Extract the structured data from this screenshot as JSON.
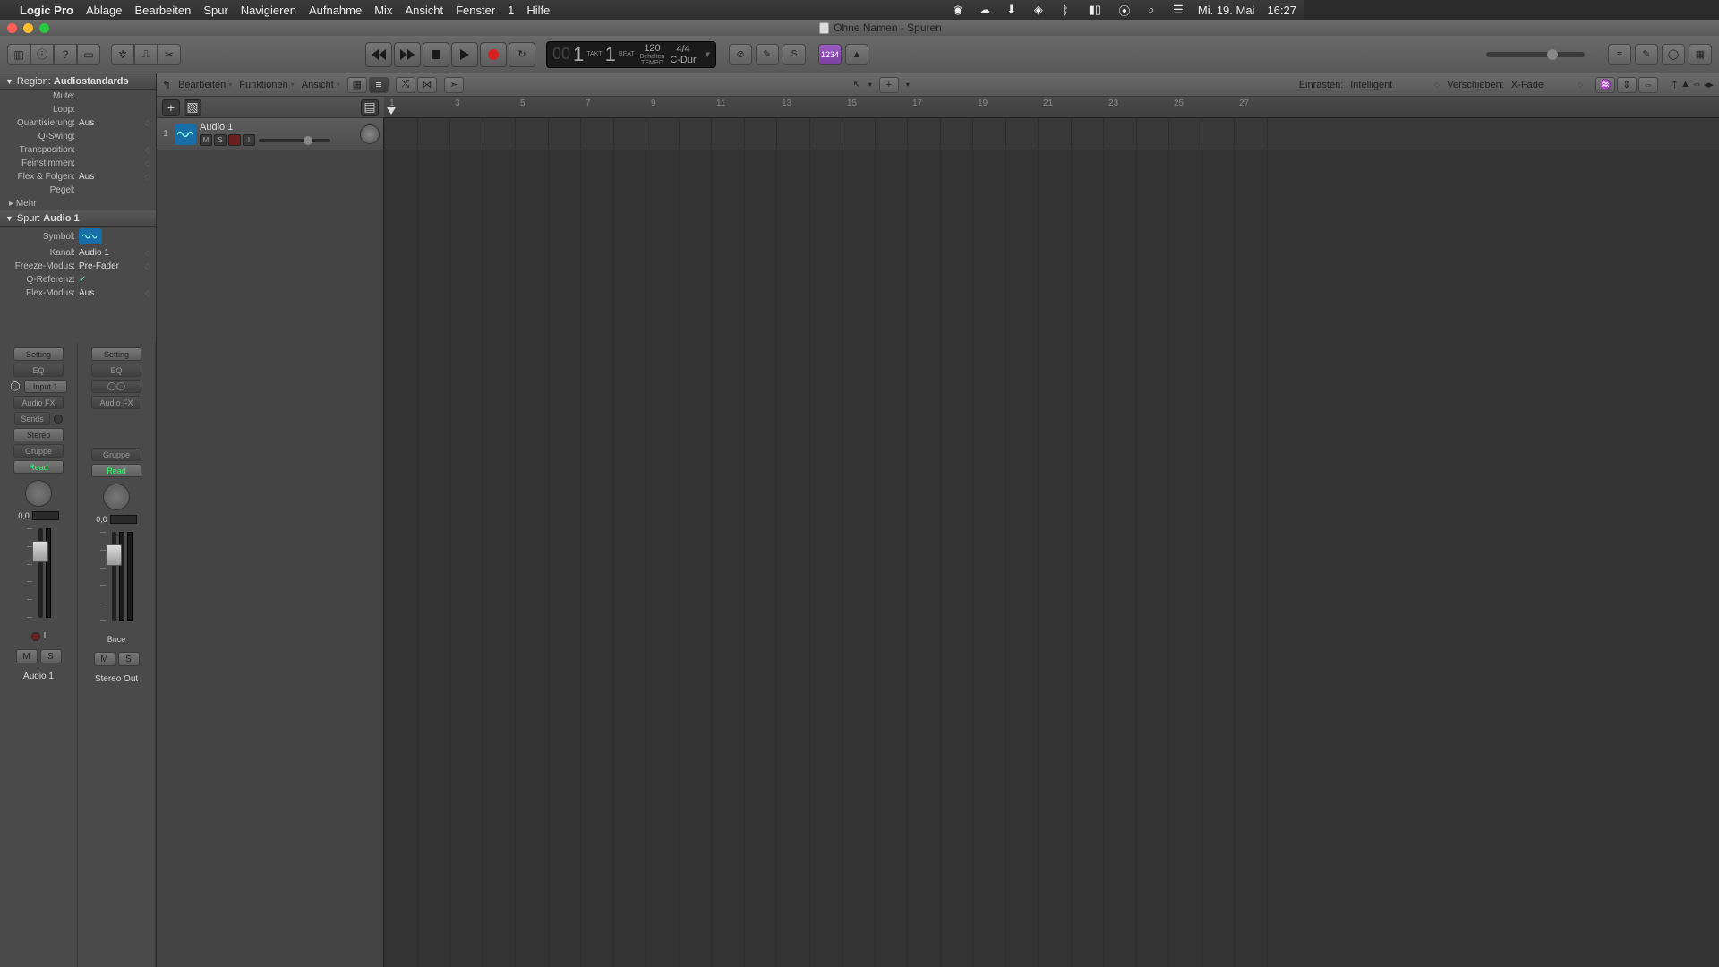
{
  "menubar": {
    "app": "Logic Pro",
    "items": [
      "Ablage",
      "Bearbeiten",
      "Spur",
      "Navigieren",
      "Aufnahme",
      "Mix",
      "Ansicht",
      "Fenster",
      "1",
      "Hilfe"
    ],
    "date": "Mi. 19. Mai",
    "time": "16:27"
  },
  "window": {
    "title": "Ohne Namen - Spuren"
  },
  "lcd": {
    "bar": "1",
    "beat": "1",
    "bar_label": "TAKT",
    "beat_label": "BEAT",
    "tempo": "120",
    "tempo_sub": "Behalten",
    "tempo_label": "TEMPO",
    "sig": "4/4",
    "key": "C-Dur"
  },
  "count_in": "1234",
  "tracks_tb": {
    "edit": "Bearbeiten",
    "funcs": "Funktionen",
    "view": "Ansicht",
    "snap_label": "Einrasten:",
    "snap_value": "Intelligent",
    "move_label": "Verschieben:",
    "move_value": "X-Fade"
  },
  "ruler_numbers": [
    "1",
    "3",
    "5",
    "7",
    "9",
    "11",
    "13",
    "15",
    "17",
    "19",
    "21",
    "23",
    "25",
    "27"
  ],
  "inspector": {
    "region_label": "Region:",
    "region_value": "Audiostandards",
    "rows": [
      {
        "lbl": "Mute:",
        "val": ""
      },
      {
        "lbl": "Loop:",
        "val": ""
      },
      {
        "lbl": "Quantisierung:",
        "val": "Aus"
      },
      {
        "lbl": "Q-Swing:",
        "val": ""
      },
      {
        "lbl": "Transposition:",
        "val": ""
      },
      {
        "lbl": "Feinstimmen:",
        "val": ""
      },
      {
        "lbl": "Flex & Folgen:",
        "val": "Aus"
      },
      {
        "lbl": "Pegel:",
        "val": ""
      }
    ],
    "mehr": "Mehr",
    "track_label": "Spur:",
    "track_value": "Audio 1",
    "track_rows": [
      {
        "lbl": "Symbol:",
        "val": ""
      },
      {
        "lbl": "Kanal:",
        "val": "Audio 1"
      },
      {
        "lbl": "Freeze-Modus:",
        "val": "Pre-Fader"
      },
      {
        "lbl": "Q-Referenz:",
        "val": "✓"
      },
      {
        "lbl": "Flex-Modus:",
        "val": "Aus"
      }
    ]
  },
  "strip": {
    "setting": "Setting",
    "eq": "EQ",
    "input": "Input 1",
    "audiofx": "Audio FX",
    "sends": "Sends",
    "stereo": "Stereo",
    "gruppe": "Gruppe",
    "read": "Read",
    "val": "0,0",
    "bnce": "Bnce",
    "m": "M",
    "s": "S",
    "i": "I",
    "name1": "Audio 1",
    "name2": "Stereo Out"
  },
  "track": {
    "name": "Audio 1",
    "m": "M",
    "s": "S",
    "r": "R",
    "i": "I",
    "num": "1"
  }
}
